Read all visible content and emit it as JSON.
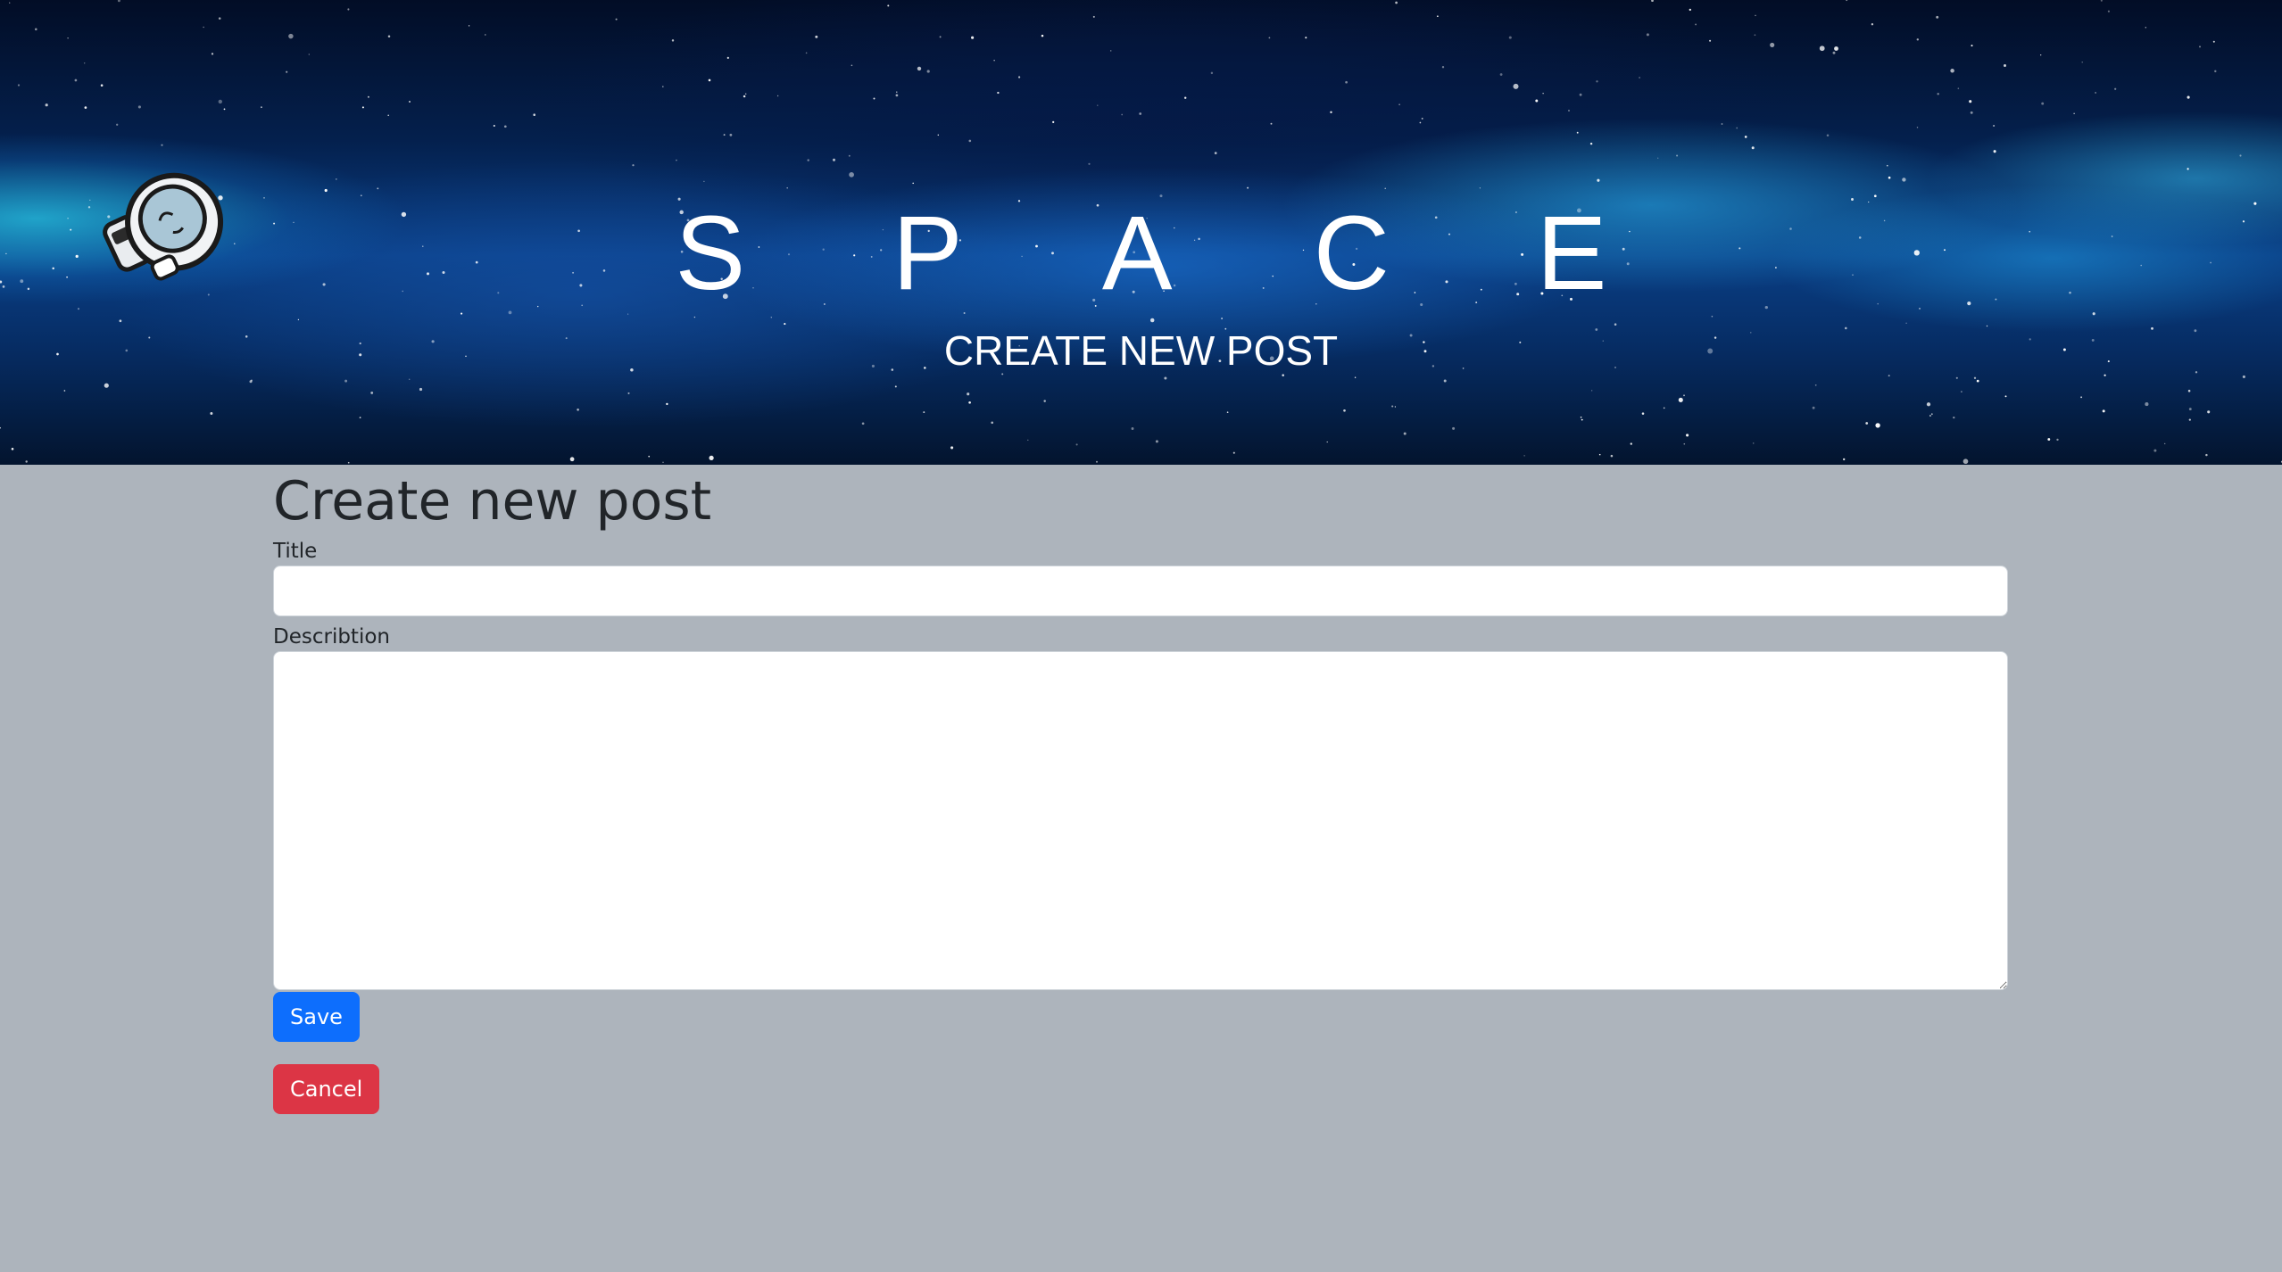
{
  "header": {
    "brand": "S P A C E",
    "subtitle": "CREATE NEW POST",
    "logo_icon": "astronaut-icon"
  },
  "form": {
    "heading": "Create new post",
    "title_label": "Title",
    "title_value": "",
    "description_label": "Describtion",
    "description_value": "",
    "save_label": "Save",
    "cancel_label": "Cancel"
  },
  "colors": {
    "page_background": "#adb4bc",
    "save_button": "#0d6efd",
    "cancel_button": "#dc3545"
  }
}
